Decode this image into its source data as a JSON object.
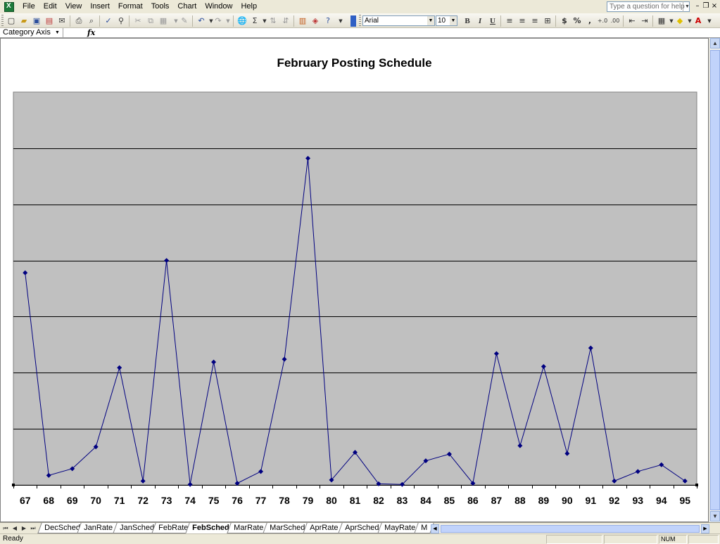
{
  "menu": {
    "items": [
      "File",
      "Edit",
      "View",
      "Insert",
      "Format",
      "Tools",
      "Chart",
      "Window",
      "Help"
    ],
    "accelerators": [
      "F",
      "E",
      "V",
      "I",
      "o",
      "T",
      "C",
      "W",
      "H"
    ],
    "help_placeholder": "Type a question for help"
  },
  "toolbar": {
    "font_name": "Arial",
    "font_size": "10",
    "bold": "B",
    "italic": "I",
    "underline": "U",
    "currency": "$",
    "percent": "%",
    "comma": ",",
    "sigma": "Σ"
  },
  "formula_bar": {
    "name_box": "Category Axis",
    "fx": "fx"
  },
  "sheet_tabs": {
    "tabs": [
      "DecSched",
      "JanRate",
      "JanSched",
      "FebRate",
      "FebSched",
      "MarRate",
      "MarSched",
      "AprRate",
      "AprSched",
      "MayRate",
      "M"
    ],
    "active": "FebSched"
  },
  "status": {
    "left": "Ready",
    "num": "NUM"
  },
  "colors": {
    "plot_bg": "#c0c0c0",
    "series": "#000080",
    "grid": "#000000"
  },
  "chart_data": {
    "type": "line",
    "title": "February Posting Schedule",
    "xlabel": "",
    "ylabel": "",
    "grid": "horizontal major gridlines on",
    "legend": "none",
    "ylim": [
      0,
      7
    ],
    "categories": [
      "67",
      "68",
      "69",
      "70",
      "71",
      "72",
      "73",
      "74",
      "75",
      "76",
      "77",
      "78",
      "79",
      "80",
      "81",
      "82",
      "83",
      "84",
      "85",
      "86",
      "87",
      "88",
      "89",
      "90",
      "91",
      "92",
      "93",
      "94",
      "95"
    ],
    "series": [
      {
        "values": [
          3.78,
          0.17,
          0.29,
          0.68,
          2.09,
          0.07,
          4.0,
          0.01,
          2.19,
          0.03,
          0.24,
          2.24,
          5.82,
          0.09,
          0.58,
          0.02,
          0.01,
          0.43,
          0.55,
          0.03,
          2.34,
          0.7,
          2.11,
          0.56,
          2.44,
          0.07,
          0.24,
          0.36,
          0.07
        ]
      }
    ]
  }
}
